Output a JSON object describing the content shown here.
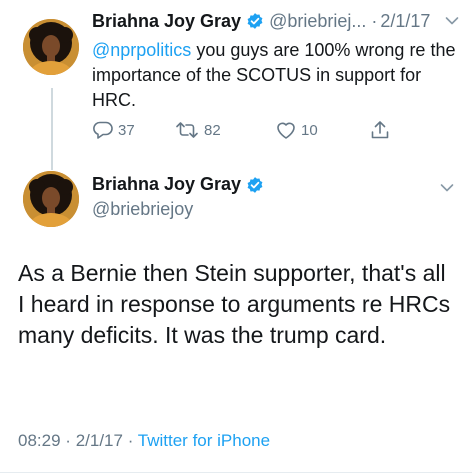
{
  "tweet1": {
    "name": "Briahna Joy Gray",
    "handle": "@briebriej...",
    "separator": "·",
    "date": "2/1/17",
    "mention": "@nprpolitics",
    "text": " you guys are 100% wrong re the importance of the SCOTUS in support for HRC.",
    "replies": "37",
    "retweets": "82",
    "likes": "10"
  },
  "tweet2": {
    "name": "Briahna Joy Gray",
    "handle": "@briebriejoy",
    "text": "As a Bernie then Stein supporter, that's all I heard in response to arguments re HRCs many deficits. It was the trump card.",
    "time": "08:29",
    "separator1": "·",
    "date": "2/1/17",
    "separator2": "·",
    "source": "Twitter for iPhone"
  },
  "colors": {
    "accent": "#1da1f2",
    "secondary_text": "#657786",
    "primary_text": "#14171a",
    "avatar_bg": "#c68a2e",
    "shirt": "#e2a03a"
  },
  "icons": {
    "verified": "verified-badge-icon",
    "chevron": "chevron-down-icon",
    "reply": "reply-icon",
    "retweet": "retweet-icon",
    "like": "heart-icon",
    "share": "share-icon"
  }
}
